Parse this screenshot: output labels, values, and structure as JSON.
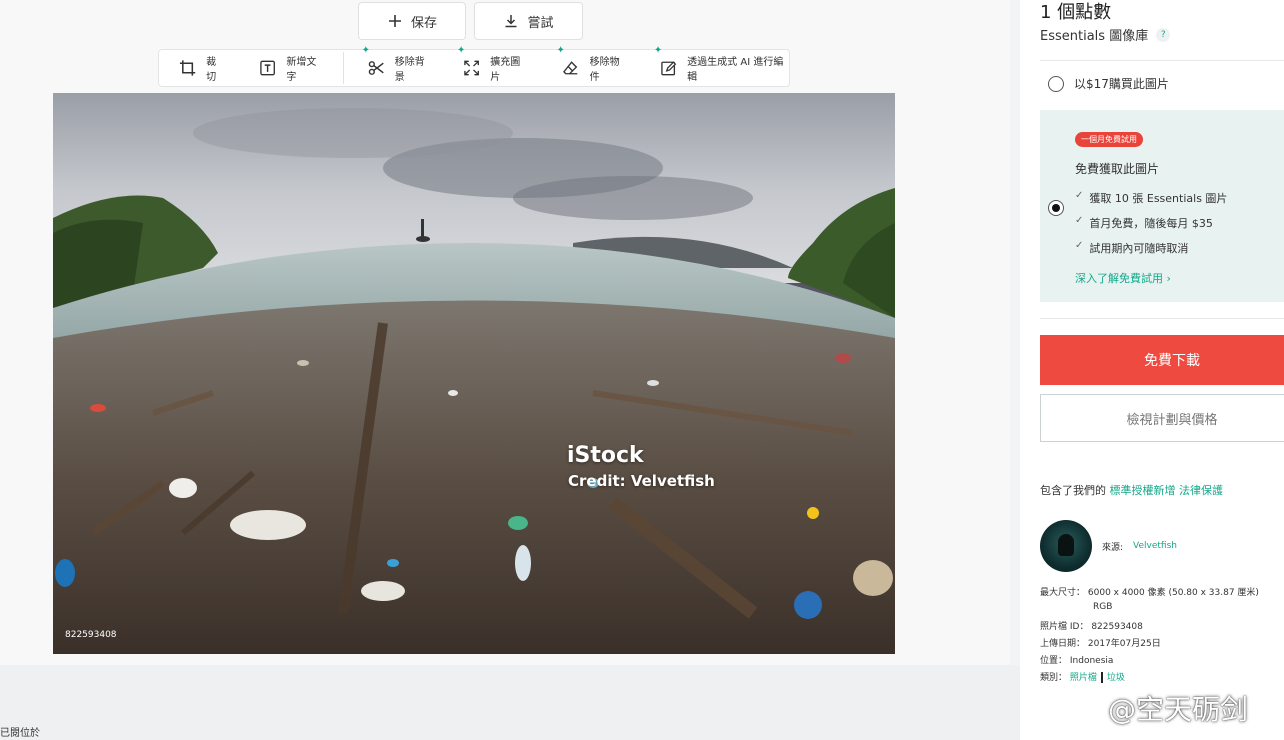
{
  "editor": {
    "save_label": "保存",
    "try_label": "嘗試",
    "tools": [
      {
        "label": "裁切",
        "icon": "crop-icon"
      },
      {
        "label": "新增文字",
        "icon": "text-icon"
      },
      {
        "label": "移除背景",
        "icon": "scissors-icon"
      },
      {
        "label": "擴充圖片",
        "icon": "expand-icon"
      },
      {
        "label": "移除物件",
        "icon": "eraser-icon"
      },
      {
        "label": "透過生成式 AI 進行編輯",
        "icon": "generative-edit-icon"
      }
    ]
  },
  "photo": {
    "watermark_logo": "iStock",
    "watermark_credit": "Credit: Velvetfish",
    "id_overlay": "822593408"
  },
  "footer": {
    "label": "已閱位於"
  },
  "license_panel": {
    "credits_title": "1 個點數",
    "library": "Essentials 圖像庫",
    "help_icon": "?",
    "buy_option": "以$17購買此圖片",
    "trial": {
      "badge": "一個月免費試用",
      "title": "免費獲取此圖片",
      "features": [
        "獲取 10 張 Essentials 圖片",
        "首月免費，隨後每月 $35",
        "試用期內可隨時取消"
      ],
      "learn_more": "深入了解免費試用 ›"
    },
    "download_label": "免費下載",
    "pricing_label": "檢視計劃與價格",
    "includes_prefix": "包含了我們的",
    "includes_link1": "標準授權新增",
    "includes_link2": "法律保護"
  },
  "creator": {
    "label": "來源:",
    "name": "Velvetfish"
  },
  "details": {
    "max_size_label": "最大尺寸：",
    "max_size_value": "6000 x 4000 像素 (50.80 x 33.87 厘米)",
    "color_mode": "RGB",
    "id_label": "照片檔 ID：",
    "id_value": "822593408",
    "upload_label": "上傳日期：",
    "upload_value": "2017年07月25日",
    "location_label": "位置：",
    "location_value": "Indonesia",
    "category_label": "類別：",
    "category_values": [
      "照片檔",
      "垃圾"
    ]
  },
  "overlay_credit": "@空天砺剑",
  "colors": {
    "accent": "#14a88a",
    "download": "#ef4a3f",
    "trial_bg": "#e8f2f1",
    "badge": "#e8443a"
  }
}
